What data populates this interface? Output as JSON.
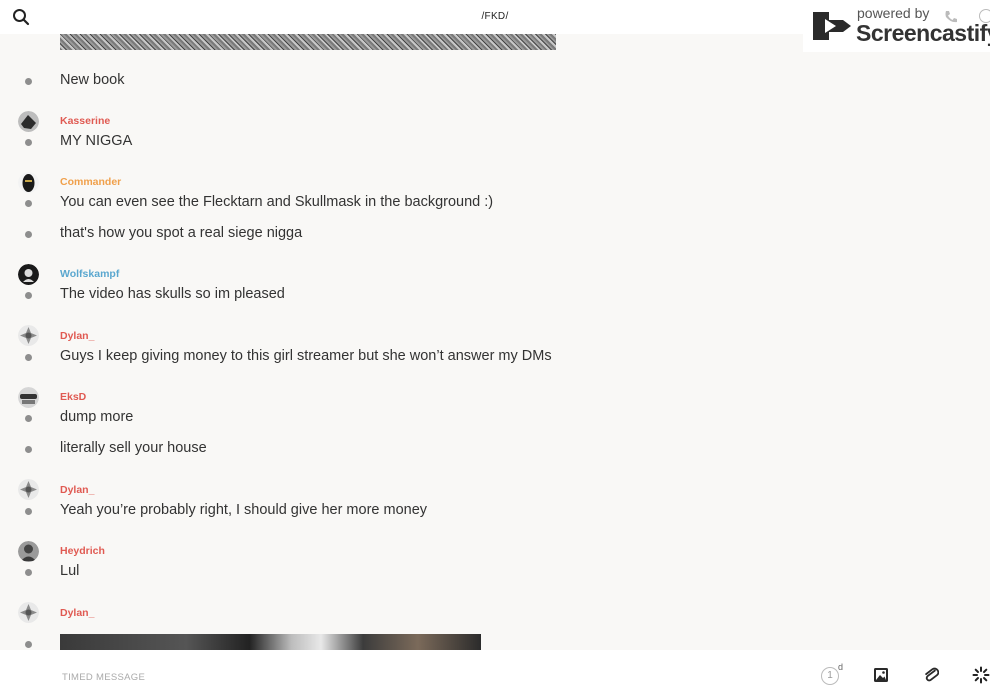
{
  "header": {
    "channel": "/FKD/",
    "brand": {
      "powered_by": "powered by",
      "name": "Screencastify"
    }
  },
  "messages": [
    {
      "text": "New book"
    },
    {
      "user": "Kasserine",
      "user_color": "#e05a52",
      "text": "MY NIGGA"
    },
    {
      "user": "Commander",
      "user_color": "#f0a04b",
      "text": "You can even see the Flecktarn and Skullmask in the background :)"
    },
    {
      "text": "that's how you spot a real siege nigga"
    },
    {
      "user": "Wolfskampf",
      "user_color": "#5aa7cf",
      "text": "The video has skulls so im pleased"
    },
    {
      "user": "Dylan_",
      "user_color": "#e05a52",
      "text": "Guys I keep giving money to this girl streamer but she won’t answer my DMs"
    },
    {
      "user": "EksD",
      "user_color": "#e05a52",
      "text": "dump more"
    },
    {
      "text": "literally sell your house"
    },
    {
      "user": "Dylan_",
      "user_color": "#e05a52",
      "text": "Yeah you’re probably right, I should give her more money"
    },
    {
      "user": "Heydrich",
      "user_color": "#e05a52",
      "text": "Lul"
    },
    {
      "user": "Dylan_",
      "user_color": "#e05a52"
    }
  ],
  "composer": {
    "placeholder": "TIMED MESSAGE",
    "timer_value": "1",
    "timer_unit": "d"
  },
  "icons": {
    "search": "search-icon",
    "image": "image-icon",
    "attach": "paperclip-icon",
    "loading": "spinner-icon"
  }
}
